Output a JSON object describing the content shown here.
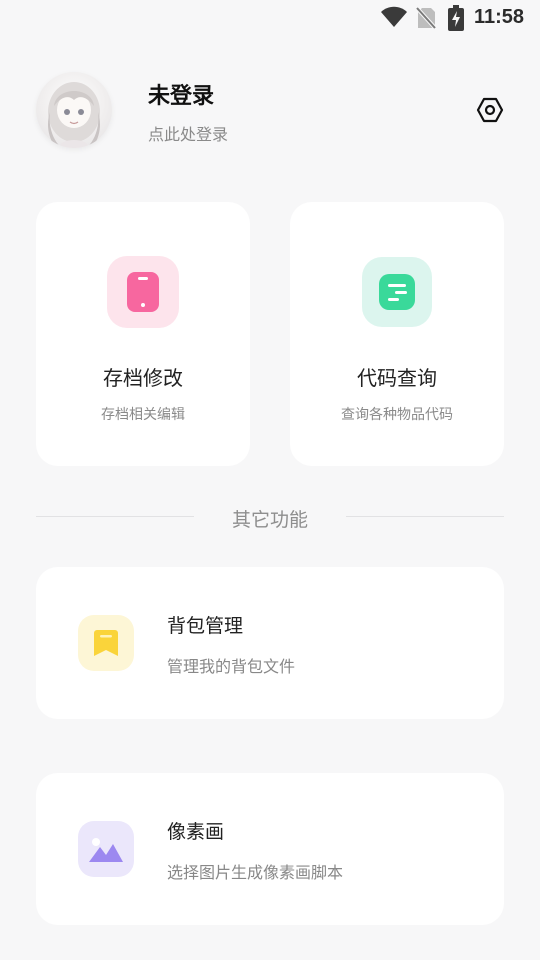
{
  "status_bar": {
    "time": "11:58",
    "icons": [
      "wifi-icon",
      "no-sim-icon",
      "battery-charging-icon"
    ]
  },
  "profile": {
    "name": "未登录",
    "subtitle": "点此处登录",
    "avatar": "anime-girl-avatar",
    "settings_icon": "settings-icon"
  },
  "feature_cards": [
    {
      "title": "存档修改",
      "subtitle": "存档相关编辑",
      "icon": "phone-icon",
      "accent": "#f7679f",
      "bg": "#fde4ec"
    },
    {
      "title": "代码查询",
      "subtitle": "查询各种物品代码",
      "icon": "code-list-icon",
      "accent": "#3ad99a",
      "bg": "#dcf5ee"
    }
  ],
  "section": {
    "label": "其它功能"
  },
  "list_items": [
    {
      "title": "背包管理",
      "subtitle": "管理我的背包文件",
      "icon": "bookmark-icon",
      "accent": "#fad43a",
      "bg": "#fdf6d6"
    },
    {
      "title": "像素画",
      "subtitle": "选择图片生成像素画脚本",
      "icon": "image-icon",
      "accent": "#9c88f0",
      "bg": "#ebe7fb"
    }
  ]
}
